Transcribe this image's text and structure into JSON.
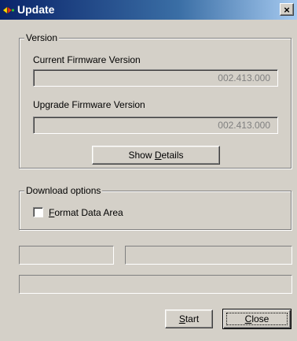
{
  "window": {
    "title": "Update",
    "close_glyph": "×"
  },
  "version_group": {
    "legend": "Version",
    "current_label": "Current Firmware Version",
    "current_value": "002.413.000",
    "upgrade_label": "Upgrade Firmware Version",
    "upgrade_value": "002.413.000",
    "details_button": {
      "prefix": "Show ",
      "accel": "D",
      "suffix": "etails"
    }
  },
  "download_group": {
    "legend": "Download options",
    "format_checkbox": {
      "accel": "F",
      "suffix": "ormat Data Area",
      "checked": false
    }
  },
  "buttons": {
    "start": {
      "accel": "S",
      "suffix": "tart"
    },
    "close": {
      "accel": "C",
      "suffix": "lose"
    }
  },
  "icons": {
    "app": "update-icon",
    "close": "close-icon",
    "checkbox": "checkbox"
  },
  "colors": {
    "titlebar_start": "#0a246a",
    "titlebar_end": "#a6caf0",
    "face": "#d4d0c8"
  }
}
